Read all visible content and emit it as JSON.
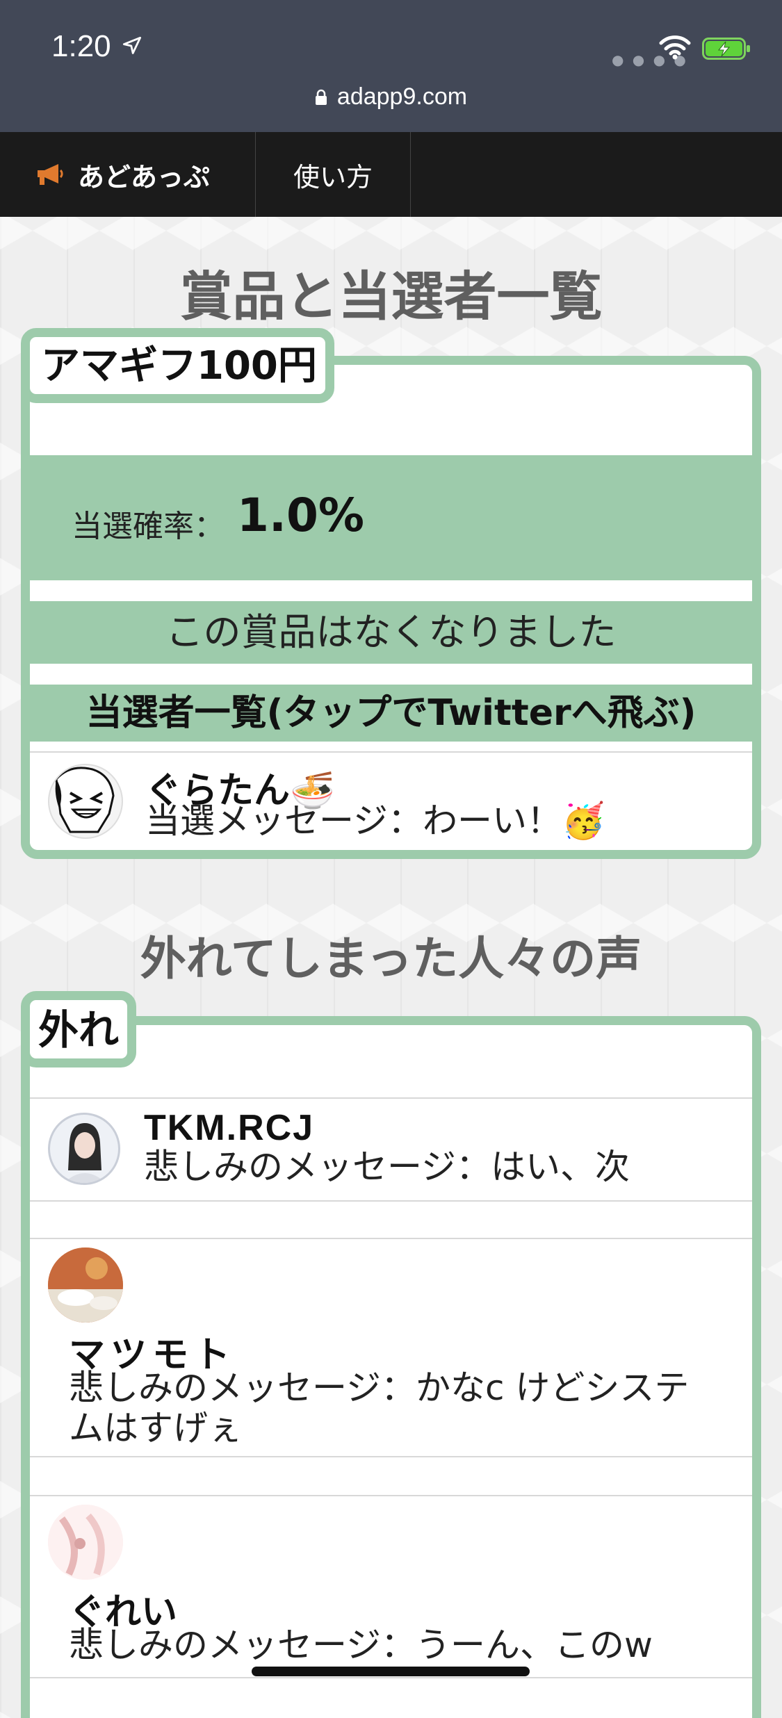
{
  "status": {
    "time": "1:20",
    "url": "adapp9.com"
  },
  "nav": {
    "brand": "あどあっぷ",
    "howto": "使い方"
  },
  "prizes": {
    "heading": "賞品と当選者一覧",
    "prize_name": "アマギフ100円",
    "prob_label": "当選確率：",
    "prob_value": "1.0%",
    "soldout": "この賞品はなくなりました",
    "winners_header": "当選者一覧(タップでTwitterへ飛ぶ)",
    "winners": [
      {
        "name": "ぐらたん🍜",
        "message": "当選メッセージ：わーい！🥳"
      }
    ]
  },
  "losers": {
    "heading": "外れてしまった人々の声",
    "tag": "外れ",
    "items": [
      {
        "name": "TKM.RCJ",
        "message": "悲しみのメッセージ：はい、次"
      },
      {
        "name": "マツモト",
        "message": "悲しみのメッセージ：かなc けどシステムはすげぇ"
      },
      {
        "name": "ぐれい",
        "message": "悲しみのメッセージ：うーん、このw"
      }
    ]
  },
  "colors": {
    "accent": "#9dcbab",
    "status_bar": "#424857",
    "nav": "#1b1b1b",
    "brand_icon": "#e07a2e"
  }
}
